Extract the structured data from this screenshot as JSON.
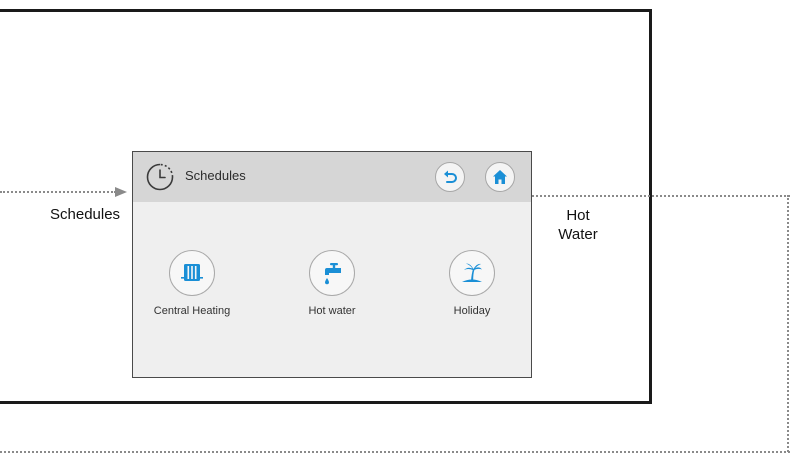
{
  "annotations": {
    "left_label": "Schedules",
    "right_label_line1": "Hot",
    "right_label_line2": "Water"
  },
  "screen": {
    "header": {
      "title": "Schedules",
      "title_icon": "clock-icon",
      "back_icon": "back-arrow-icon",
      "home_icon": "home-icon"
    },
    "tiles": [
      {
        "label": "Central Heating",
        "icon": "radiator-icon"
      },
      {
        "label": "Hot water",
        "icon": "tap-icon"
      },
      {
        "label": "Holiday",
        "icon": "palm-tree-icon"
      }
    ]
  },
  "colors": {
    "accent": "#1a8fd6",
    "header_bg": "#d6d6d6",
    "screen_bg": "#efefef",
    "frame": "#1a1a1a",
    "connector": "#8a8a8a"
  }
}
